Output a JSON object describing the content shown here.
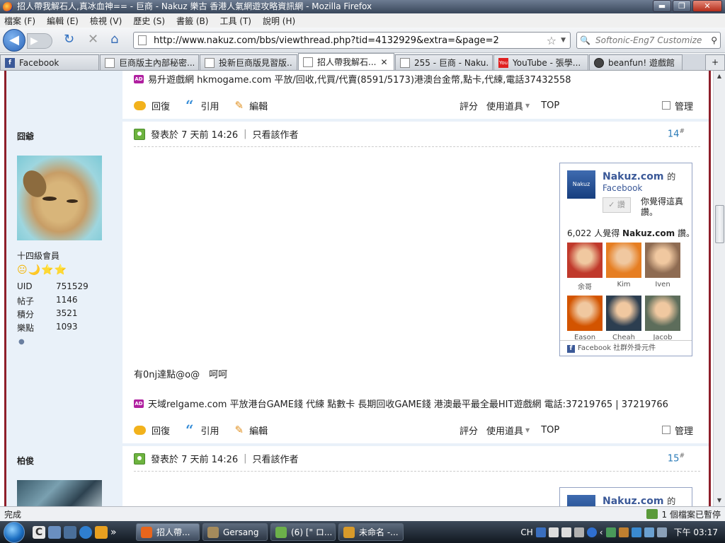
{
  "window": {
    "title": "招人帶我解石人,真冰血神== - 巨商 - Nakuz 樂古 香港人氣網遊攻略資訊網 - Mozilla Firefox",
    "minimize": "▬",
    "maximize": "❐",
    "close": "✕"
  },
  "menu": [
    "檔案 (F)",
    "編輯 (E)",
    "檢視 (V)",
    "歷史 (S)",
    "書籤 (B)",
    "工具 (T)",
    "說明 (H)"
  ],
  "nav": {
    "back": "◀",
    "forward": "▶",
    "reload": "↻",
    "stop": "✕",
    "home": "⌂",
    "url": "http://www.nakuz.com/bbs/viewthread.php?tid=4132929&extra=&page=2",
    "search_placeholder": "Softonic-Eng7 Customize",
    "bookmark_star": "☆"
  },
  "tabs": [
    {
      "label": "Facebook",
      "icon": "fb"
    },
    {
      "label": "巨商版主內部秘密...",
      "icon": "page"
    },
    {
      "label": "投新巨商版見習版...",
      "icon": "page"
    },
    {
      "label": "招人帶我解石...",
      "icon": "page",
      "active": true
    },
    {
      "label": "255 - 巨商 - Naku...",
      "icon": "page"
    },
    {
      "label": "YouTube - 張學...",
      "icon": "yt"
    },
    {
      "label": "beanfun! 遊戲館",
      "icon": "bf"
    }
  ],
  "tab_more": "+",
  "post1_footer": {
    "ad_text": "易升遊戲網 hkmogame.com 平放/回收,代買/代賣(8591/5173)港澳台金幣,點卡,代練,電話37432558",
    "reply": "回復",
    "quote": "引用",
    "edit": "編輯",
    "rate": "評分",
    "use_item": "使用道具",
    "top": "TOP",
    "manage": "管理"
  },
  "post2": {
    "username": "囧爺",
    "rank": "十四級會員",
    "stars": "😐🌙⭐⭐",
    "stats": [
      {
        "k": "UID",
        "v": "751529"
      },
      {
        "k": "帖子",
        "v": "1146"
      },
      {
        "k": "積分",
        "v": "3521"
      },
      {
        "k": "樂點",
        "v": "1093"
      }
    ],
    "posted": "發表於 7 天前 14:26",
    "author_only": "只看該作者",
    "floor": "14",
    "floor_mark": "#",
    "message": "有0nj達點@o@　呵呵",
    "ad_text": "天域relgame.com 平放港台GAME錢 代練 點數卡 長期回收GAME錢 港澳最平最全最HIT遊戲網 電話:37219765 | 37219766",
    "reply": "回復",
    "quote": "引用",
    "edit": "編輯",
    "rate": "評分",
    "use_item": "使用道具",
    "top": "TOP",
    "manage": "管理"
  },
  "fbbox": {
    "logo": "Nakuz",
    "site": "Nakuz.com",
    "de": "的",
    "facebook": "Facebook",
    "like_btn": "讚",
    "like_hint": "你覺得這真讚。",
    "count": "6,022",
    "count_pre": "人覺得",
    "count_site": "Nakuz.com",
    "count_post": "讚。",
    "fans": [
      {
        "name": "余哥",
        "color": "#c0392b"
      },
      {
        "name": "Kim",
        "color": "#e67e22"
      },
      {
        "name": "Iven",
        "color": "#8e6b52"
      },
      {
        "name": "Eason",
        "color": "#d35400"
      },
      {
        "name": "Cheah",
        "color": "#2c3e50"
      },
      {
        "name": "Jacob",
        "color": "#5d6d5b"
      }
    ],
    "footer": "Facebook 社群外掛元件"
  },
  "post3": {
    "username": "柏俊",
    "posted": "發表於 7 天前 14:26",
    "author_only": "只看該作者",
    "floor": "15",
    "floor_mark": "#",
    "site": "Nakuz.com",
    "de": "的"
  },
  "status": {
    "left": "完成",
    "right": "1 個檔案已暫停"
  },
  "taskbar": {
    "buttons": [
      {
        "label": "招人帶...",
        "active": true,
        "color": "#e8651c"
      },
      {
        "label": "Gersang",
        "color": "#a58b5c"
      },
      {
        "label": "(6) [\" ロ...",
        "color": "#6cb04a"
      },
      {
        "label": "未命名 -...",
        "color": "#d89a2a"
      }
    ],
    "lang": "CH",
    "clock": "下午 03:17",
    "more": "»"
  }
}
